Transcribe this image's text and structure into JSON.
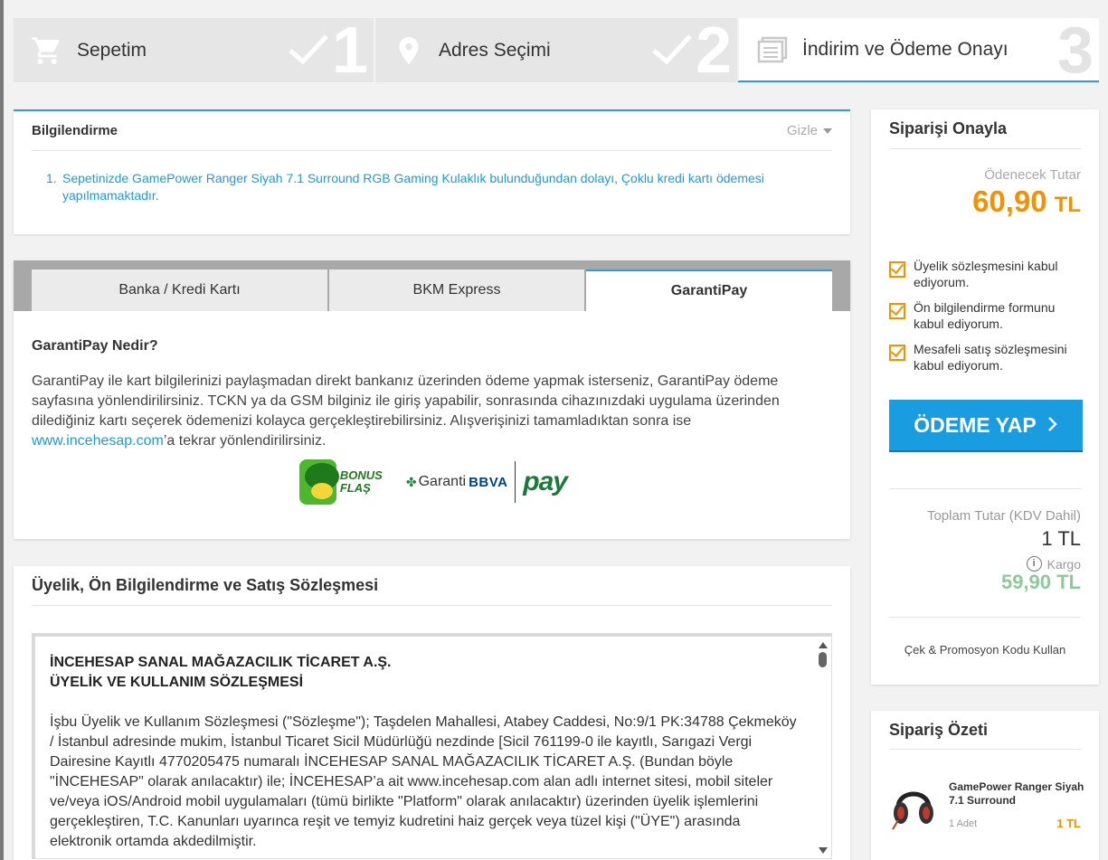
{
  "steps": [
    {
      "label": "Sepetim",
      "number": "1",
      "icon": "cart-icon",
      "done": true
    },
    {
      "label": "Adres Seçimi",
      "number": "2",
      "icon": "location-pin-icon",
      "done": true
    },
    {
      "label": "İndirim ve Ödeme Onayı",
      "number": "3",
      "icon": "list-icon",
      "done": false
    }
  ],
  "info": {
    "title": "Bilgilendirme",
    "hide_label": "Gizle",
    "messages": [
      {
        "num": "1.",
        "text": "Sepetinizde GamePower Ranger Siyah 7.1 Surround RGB Gaming Kulaklık bulunduğundan dolayı, Çoklu kredi kartı ödemesi yapılmamaktadır."
      }
    ]
  },
  "payment": {
    "tabs": [
      "Banka / Kredi Kartı",
      "BKM Express",
      "GarantiPay"
    ],
    "active_tab": "GarantiPay",
    "title": "GarantiPay Nedir?",
    "description": "GarantiPay ile kart bilgilerinizi paylaşmadan direkt bankanız üzerinden ödeme yapmak isterseniz, GarantiPay ödeme sayfasına yönlendirilirsiniz. TCKN ya da GSM bilginiz ile giriş yapabilir, sonrasında cihazınızdaki uygulama üzerinden dilediğiniz kartı seçerek ödemenizi kolayca gerçekleştirebilirsiniz. Alışverişinizi tamamladıktan sonra ise ",
    "link_text": "www.incehesap.com",
    "description_end": "’a tekrar yönlendirilirsiniz.",
    "logos": {
      "bonus": "BONUS FLAŞ",
      "garanti": "Garanti",
      "bbva": "BBVA",
      "pay": "pay"
    }
  },
  "contract": {
    "title": "Üyelik, Ön Bilgilendirme ve Satış Sözleşmesi",
    "heading_1": "İNCEHESAP SANAL MAĞAZACILIK TİCARET A.Ş.",
    "heading_2": "ÜYELİK VE KULLANIM SÖZLEŞMESİ",
    "body": "İşbu Üyelik ve Kullanım Sözleşmesi (\"Sözleşme\"); Taşdelen Mahallesi, Atabey Caddesi, No:9/1 PK:34788 Çekmeköy / İstanbul adresinde mukim, İstanbul Ticaret Sicil Müdürlüğü nezdinde [Sicil 761199-0 ile kayıtlı, Sarıgazi Vergi Dairesine Kayıtlı 4770205475 numaralı İNCEHESAP SANAL MAĞAZACILIK TİCARET A.Ş. (Bundan böyle \"İNCEHESAP\" olarak anılacaktır) ile; İNCEHESAP’a ait www.incehesap.com alan adlı internet sitesi, mobil siteler ve/veya iOS/Android mobil uygulamaları (tümü birlikte \"Platform\" olarak anılacaktır) üzerinden üyelik işlemlerini gerçekleştiren, T.C. Kanunları uyarınca reşit ve temyiz kudretini haiz gerçek veya tüzel kişi (\"ÜYE\") arasında elektronik ortamda akdedilmiştir."
  },
  "confirm": {
    "title": "Siparişi Onayla",
    "payable_label": "Ödenecek Tutar",
    "payable_amount": "60,90",
    "currency": "TL",
    "agreements": [
      "Üyelik sözleşmesini kabul ediyorum.",
      "Ön bilgilendirme formunu kabul ediyorum.",
      "Mesafeli satış sözleşmesini kabul ediyorum."
    ],
    "pay_button": "ÖDEME YAP",
    "total_label": "Toplam Tutar (KDV Dahil)",
    "total_value": "1 TL",
    "shipping_label": "Kargo",
    "shipping_value": "59,90 TL",
    "promo_label": "Çek & Promosyon Kodu Kullan"
  },
  "summary": {
    "title": "Sipariş Özeti",
    "product_name": "GamePower Ranger Siyah 7.1 Surround",
    "quantity": "1 Adet",
    "price": "1 TL"
  },
  "colors": {
    "accent_blue": "#2d9bd8",
    "button_blue": "#1a9de0",
    "orange": "#f39200",
    "green": "#8fc99a"
  }
}
